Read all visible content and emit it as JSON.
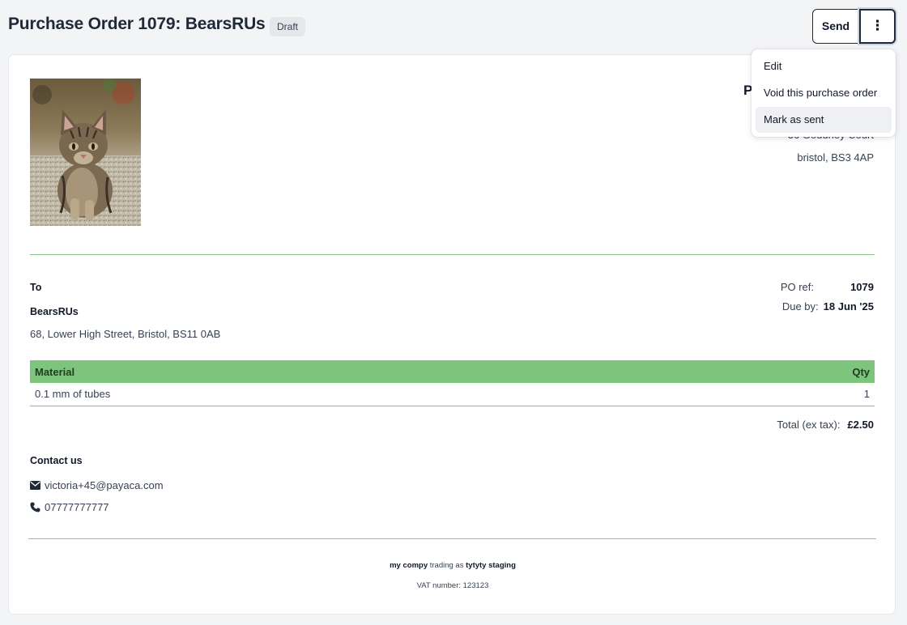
{
  "header": {
    "title": "Purchase Order 1079: BearsRUs",
    "status_badge": "Draft",
    "send_label": "Send",
    "more_label": "⋮"
  },
  "supplier_company": {
    "name_partial": "P",
    "address_line1": "36 Goudney Court",
    "address_line2": "bristol, BS3 4AP"
  },
  "recipient": {
    "to_label": "To",
    "name": "BearsRUs",
    "address": "68, Lower High Street, Bristol, BS11 0AB"
  },
  "meta": {
    "po_ref_label": "PO ref:",
    "po_ref_value": "1079",
    "due_by_label": "Due by:",
    "due_by_value": "18 Jun '25"
  },
  "items_table": {
    "columns": [
      "Material",
      "Qty"
    ],
    "rows": [
      {
        "material": "0.1 mm of tubes",
        "qty": "1"
      }
    ]
  },
  "totals": {
    "label": "Total (ex tax):",
    "value": "£2.50"
  },
  "contact": {
    "heading": "Contact us",
    "email": "victoria+45@payaca.com",
    "phone": "07777777777",
    "email_icon": "envelope-icon",
    "phone_icon": "phone-icon"
  },
  "footer": {
    "company": "my compy",
    "trading_as_text": "trading as",
    "trading_name": "tytyty staging",
    "vat": "VAT number: 123123"
  },
  "menu": {
    "items": [
      {
        "label": "Edit"
      },
      {
        "label": "Void this purchase order"
      },
      {
        "label": "Mark as sent"
      }
    ]
  },
  "colors": {
    "accent_green": "#7dc47d",
    "rule_green": "#8dc98f"
  }
}
